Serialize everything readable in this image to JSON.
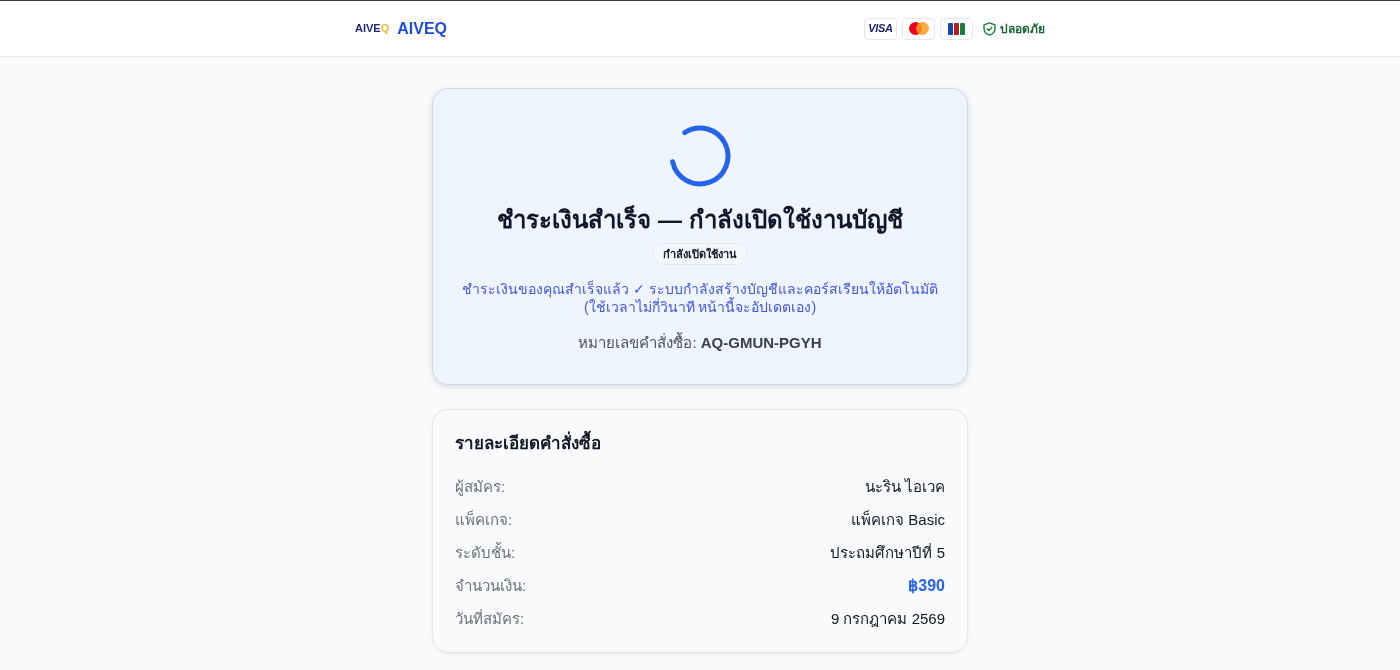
{
  "header": {
    "logo": {
      "text": "AIVE",
      "accent": "Q"
    },
    "brand": "AIVEQ",
    "payment_badges": [
      {
        "kind": "text",
        "text": "VISA"
      },
      {
        "kind": "circles"
      },
      {
        "kind": "bars"
      }
    ],
    "security_label": "ปลอดภัย"
  },
  "status_card": {
    "title": "ชำระเงินสำเร็จ — กำลังเปิดใช้งานบัญชี",
    "badge": "กำลังเปิดใช้งาน",
    "message": "ชำระเงินของคุณสำเร็จแล้ว ✓ ระบบกำลังสร้างบัญชีและคอร์สเรียนให้อัตโนมัติ (ใช้เวลาไม่กี่วินาที หน้านี้จะอัปเดตเอง)",
    "order": "หมายเลขคำสั่งซื้อ: **AQ-GMUN-PGYH**"
  },
  "details": {
    "title": "รายละเอียดคำสั่งซื้อ",
    "rows": [
      {
        "kind": "text",
        "label": "ผู้สมัคร:",
        "value": "นะริน ไอเวค"
      },
      {
        "kind": "text",
        "label": "แพ็คเกจ:",
        "value": "แพ็คเกจ Basic"
      },
      {
        "kind": "text",
        "label": "ระดับชั้น:",
        "value": "ประถมศึกษาปีที่ 5"
      },
      {
        "kind": "amount",
        "label": "จำนวนเงิน:",
        "value": "฿390"
      },
      {
        "kind": "text",
        "label": "วันที่สมัคร:",
        "value": "9 กรกฎาคม 2569"
      }
    ]
  }
}
